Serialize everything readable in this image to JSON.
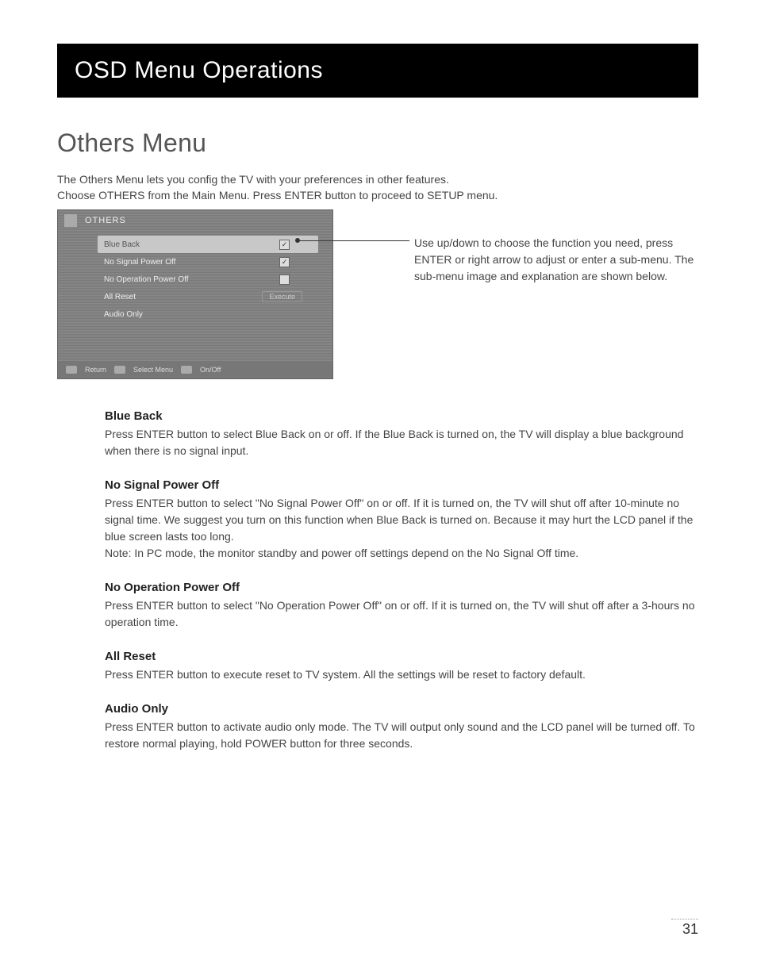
{
  "header": {
    "title": "OSD Menu Operations"
  },
  "section": {
    "title": "Others Menu"
  },
  "intro": {
    "line1": "The Others Menu lets you config the TV with your preferences in other features.",
    "line2": "Choose OTHERS from the Main Menu. Press ENTER button to proceed to SETUP menu."
  },
  "osd": {
    "title": "OTHERS",
    "rows": [
      {
        "label": "Blue Back",
        "control": "check",
        "checked": true,
        "selected": true
      },
      {
        "label": "No Signal Power Off",
        "control": "check",
        "checked": true,
        "selected": false
      },
      {
        "label": "No Operation Power Off",
        "control": "check",
        "checked": false,
        "selected": false
      },
      {
        "label": "All Reset",
        "control": "execute",
        "exec_label": "Execute",
        "selected": false
      },
      {
        "label": "Audio Only",
        "control": "none",
        "selected": false
      }
    ],
    "footer": {
      "return": "Return",
      "select": "Select Menu",
      "onoff": "On/Off"
    }
  },
  "callout": {
    "text": "Use up/down to choose the function you need, press ENTER or right arrow to adjust or enter a sub-menu. The sub-menu image and explanation are shown below."
  },
  "descriptions": [
    {
      "title": "Blue Back",
      "body": "Press ENTER button to select Blue Back on or off. If the Blue Back is turned on, the TV will display a blue background when there is no signal input."
    },
    {
      "title": "No Signal Power Off",
      "body": "Press ENTER button to select \"No Signal Power Off\" on or off. If it is turned on, the TV will shut off after 10-minute no signal time. We suggest you turn on this function when Blue Back is turned on. Because it may hurt the LCD panel if the blue screen lasts too long.\nNote: In PC mode, the monitor standby and power off settings depend on the No Signal Off time."
    },
    {
      "title": "No Operation Power Off",
      "body": "Press ENTER button to select \"No Operation Power Off\" on or off. If it is turned on, the TV will shut off after a  3-hours no operation time."
    },
    {
      "title": "All Reset",
      "body": "Press ENTER button to execute reset to TV system. All the settings will be reset to factory default."
    },
    {
      "title": "Audio Only",
      "body": "Press ENTER button to activate audio only mode. The TV will output only sound and the LCD panel will be turned off. To restore normal playing, hold POWER button for three seconds."
    }
  ],
  "page_number": "31"
}
